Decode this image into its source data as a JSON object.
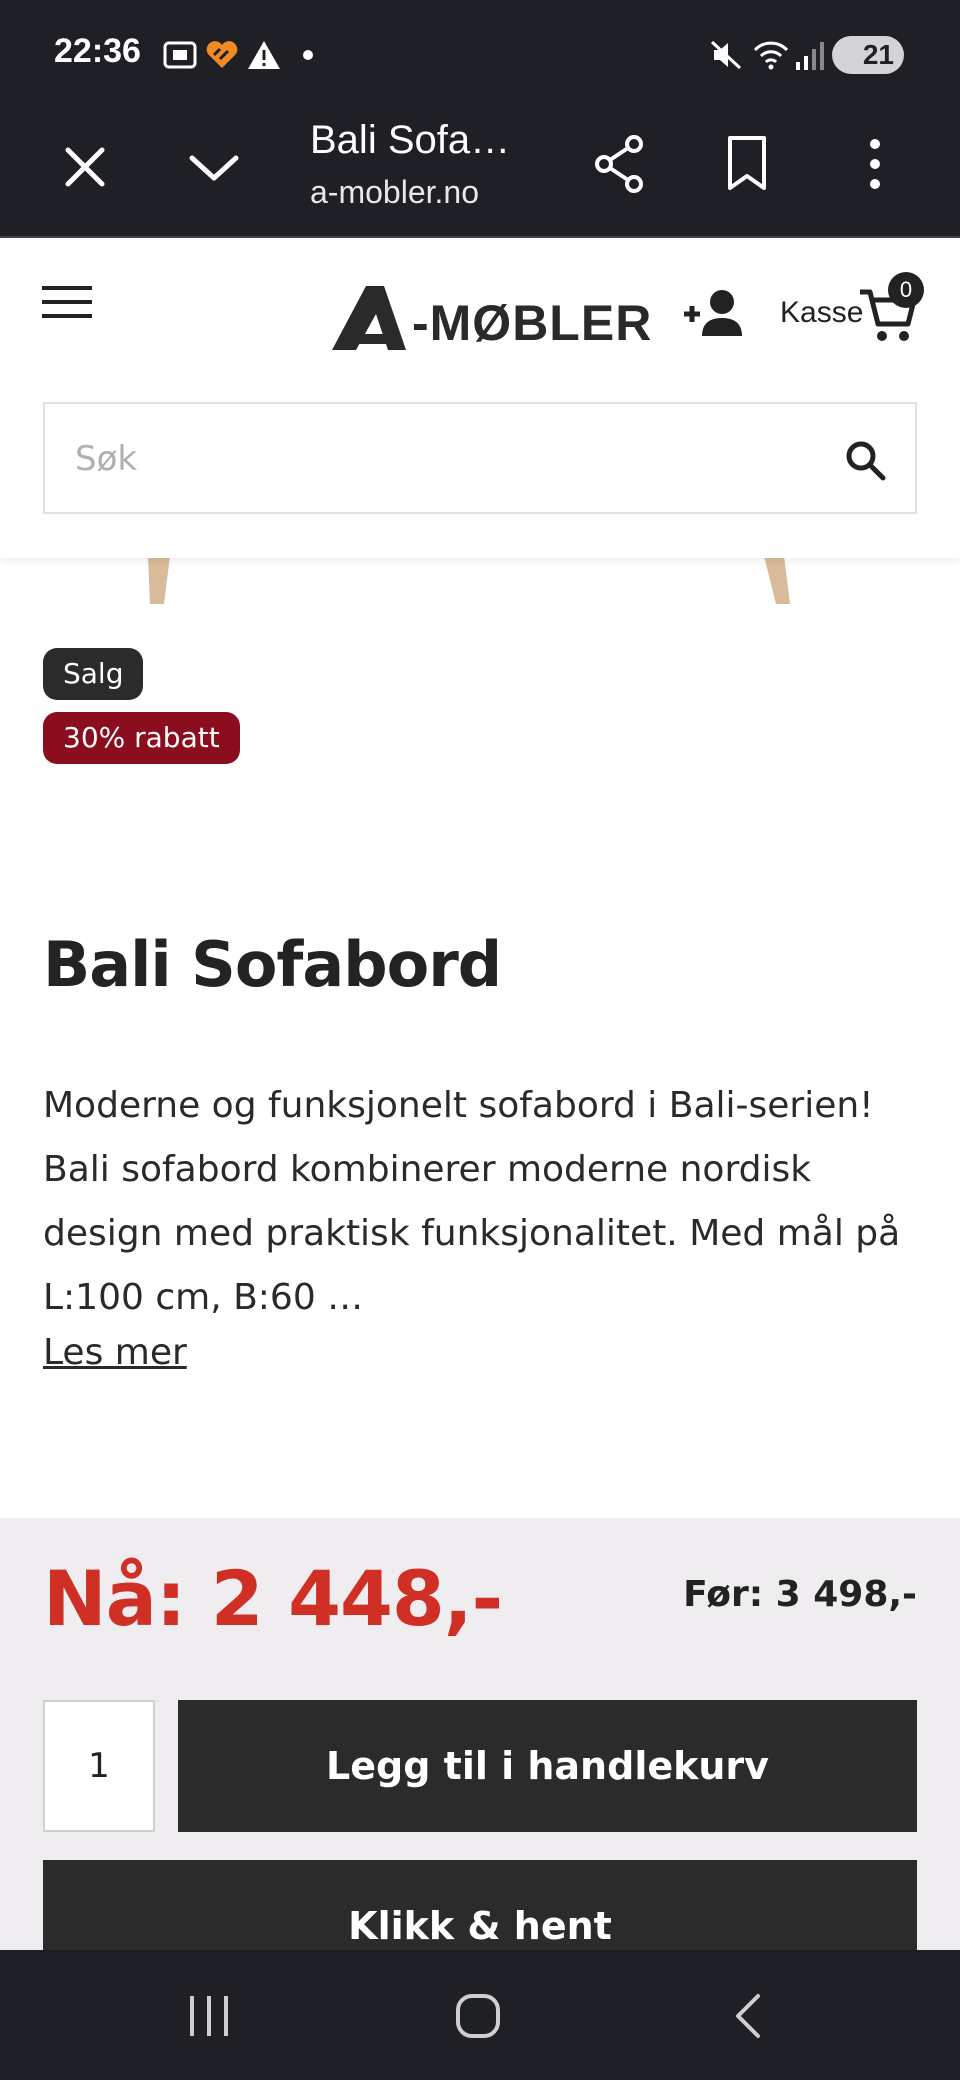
{
  "status_bar": {
    "time": "22:36",
    "battery": "21",
    "icons": [
      "screenshot-icon",
      "heart-app-icon",
      "warning-icon",
      "dot-icon",
      "mute-icon",
      "wifi-icon",
      "signal-icon",
      "battery-icon"
    ]
  },
  "browser": {
    "tab_title": "Bali Sofa…",
    "url": "a-mobler.no",
    "icons": [
      "close-icon",
      "chevron-down-icon",
      "share-icon",
      "bookmark-icon",
      "more-vert-icon"
    ]
  },
  "header": {
    "logo_text": "-MØBLER",
    "checkout_label": "Kasse",
    "cart_count": "0",
    "search_placeholder": "Søk"
  },
  "product": {
    "badge_sale": "Salg",
    "badge_discount": "30% rabatt",
    "title": "Bali Sofabord",
    "description": "Moderne og funksjonelt sofabord i Bali-serien! Bali sofabord kombinerer moderne nordisk design med praktisk funksjonalitet. Med mål på L:100 cm, B:60 …",
    "read_more": "Les mer"
  },
  "pricing": {
    "price_now": "Nå: 2 448,-",
    "price_before": "Før: 3 498,-",
    "quantity": "1",
    "add_to_cart_label": "Legg til i handlekurv",
    "click_collect_label": "Klikk & hent"
  },
  "colors": {
    "dark": "#1f2026",
    "price_red": "#cf2f25",
    "discount_badge": "#8b0d1e",
    "button": "#2b2b2b",
    "price_bg": "#f0edf0"
  }
}
